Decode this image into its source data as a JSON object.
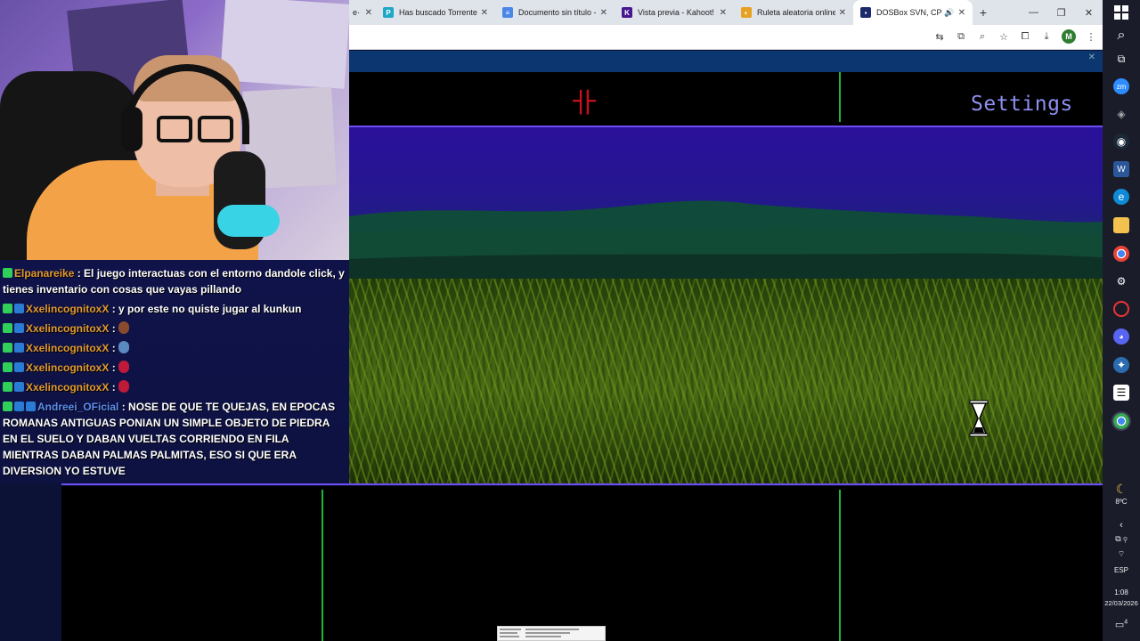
{
  "browser": {
    "tabs": [
      {
        "title": "e·",
        "favicon_color": "#777777",
        "favicon_glyph": "",
        "partial": true
      },
      {
        "title": "Has buscado Torrente - ",
        "favicon_color": "#1ea7c6",
        "favicon_glyph": "P"
      },
      {
        "title": "Documento sin título - ",
        "favicon_color": "#4a86e8",
        "favicon_glyph": "≡"
      },
      {
        "title": "Vista previa - Kahoot!",
        "favicon_color": "#46178f",
        "favicon_glyph": "K"
      },
      {
        "title": "Ruleta aleatoria online",
        "favicon_color": "#e8a020",
        "favicon_glyph": "◐"
      },
      {
        "title": "DOSBox SVN, CPU s",
        "favicon_color": "#1b2a6b",
        "favicon_glyph": "▪",
        "active": true,
        "audio": true
      }
    ],
    "new_tab": "+",
    "window_controls": {
      "minimize": "—",
      "restore": "❐",
      "close": "✕"
    },
    "toolbar_icons": [
      "translate-icon",
      "install-icon",
      "zoom-icon",
      "bookmark-star-icon",
      "extensions-icon",
      "download-icon"
    ],
    "profile_initial": "M"
  },
  "game": {
    "settings_label": "Settings",
    "logo_glyph": "卝",
    "close_glyph": "✕"
  },
  "chat": {
    "messages": [
      {
        "user": "Elpanareike",
        "badges": [
          "k"
        ],
        "user_color": "orange",
        "text": "El juego interactuas con el entorno dandole click, y tienes inventario con cosas que vayas pillando"
      },
      {
        "user": "XxelincognitoxX",
        "badges": [
          "k",
          "b"
        ],
        "user_color": "orange",
        "text": "y por este no quiste jugar al kunkun"
      },
      {
        "user": "XxelincognitoxX",
        "badges": [
          "k",
          "b"
        ],
        "user_color": "orange",
        "text": "",
        "emote_color": "#8a4a2e"
      },
      {
        "user": "XxelincognitoxX",
        "badges": [
          "k",
          "b"
        ],
        "user_color": "orange",
        "text": "",
        "emote_color": "#5a8ac0"
      },
      {
        "user": "XxelincognitoxX",
        "badges": [
          "k",
          "b"
        ],
        "user_color": "orange",
        "text": "",
        "emote_color": "#c01a3a"
      },
      {
        "user": "XxelincognitoxX",
        "badges": [
          "k",
          "b"
        ],
        "user_color": "orange",
        "text": "",
        "emote_color": "#c01a3a"
      },
      {
        "user": "Andreei_OFicial",
        "badges": [
          "k",
          "b",
          "b"
        ],
        "user_color": "blue",
        "text": "NOSE DE QUE TE QUEJAS, EN EPOCAS ROMANAS ANTIGUAS PONIAN UN SIMPLE OBJETO DE PIEDRA EN EL SUELO Y DABAN VUELTAS CORRIENDO EN FILA MIENTRAS DABAN PALMAS PALMITAS, ESO SI QUE ERA DIVERSION YO ESTUVE"
      }
    ]
  },
  "taskbar": {
    "search_icon": "⌕",
    "weather_temp": "8ºC",
    "language": "ESP",
    "time": "1:08",
    "date": "22/03/2026",
    "notification_count": "4"
  },
  "colors": {
    "settings_text": "#8e8ff0",
    "logo_red": "#c3121e",
    "green_divider": "#1fb53a",
    "purple_divider": "#6c4ef0",
    "username_orange": "#e29a2e",
    "username_blue": "#5e8ef2"
  }
}
